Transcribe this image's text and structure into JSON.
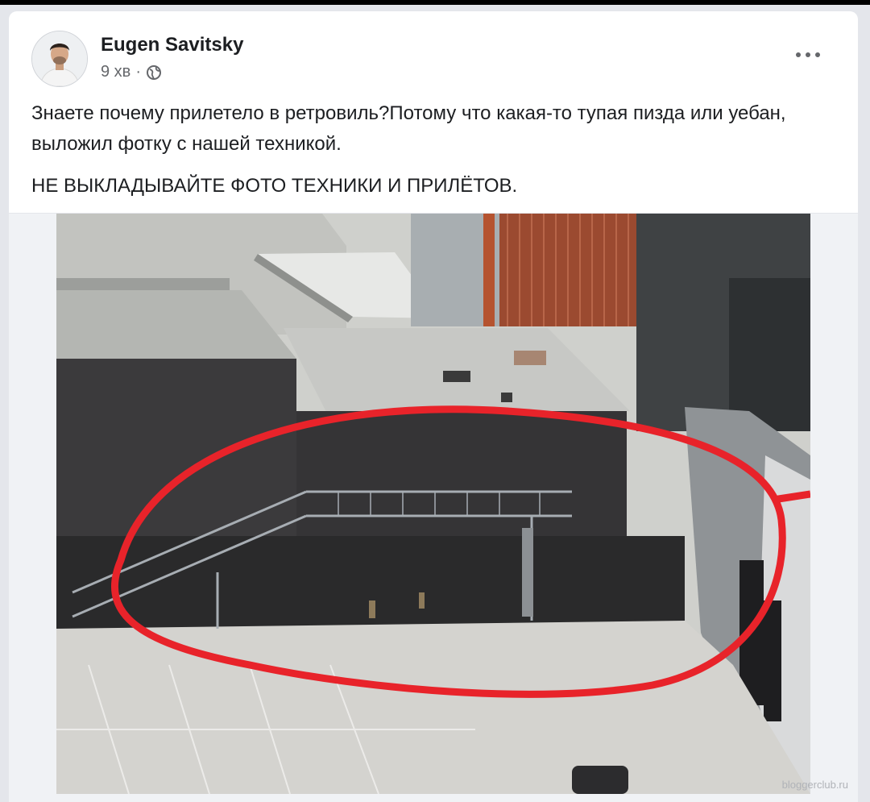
{
  "post": {
    "author": "Eugen Savitsky",
    "time": "9 хв",
    "separator": "·",
    "privacy_icon": "globe-icon",
    "more_icon": "more-options-icon",
    "text_line1": "Знаете почему прилетело в ретровиль?Потому что какая-то тупая пизда или уебан, выложил фотку с нашей техникой.",
    "text_line2": "НЕ ВЫКЛАДЫВАЙТЕ ФОТО ТЕХНИКИ И ПРИЛЁТОВ.",
    "photo_watermark": "bloggerclub.ru"
  },
  "colors": {
    "highlight_circle": "#e8232a",
    "card_bg": "#ffffff",
    "page_bg": "#e4e6eb"
  }
}
